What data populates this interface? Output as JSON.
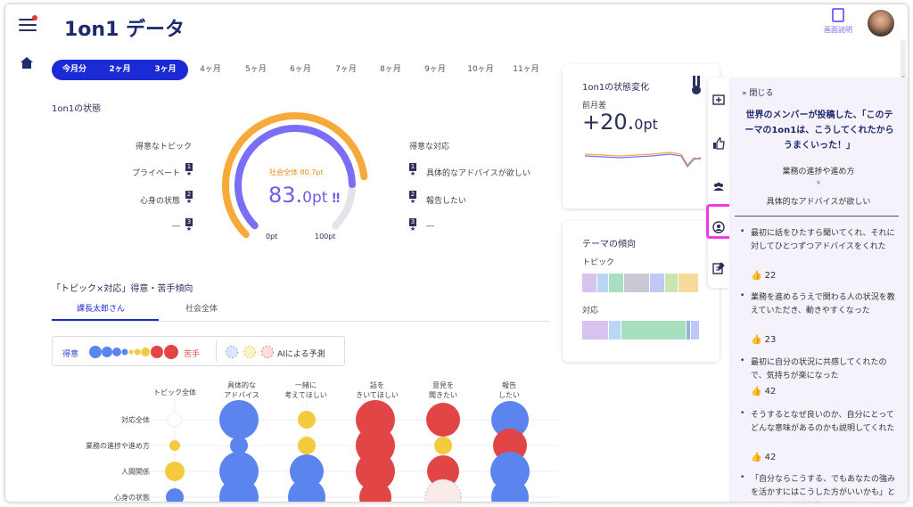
{
  "header": {
    "title": "1on1 データ",
    "help_label": "画面説明"
  },
  "period": {
    "active": [
      "今月分",
      "2ヶ月",
      "3ヶ月"
    ],
    "others": [
      "4ヶ月",
      "5ヶ月",
      "6ヶ月",
      "7ヶ月",
      "8ヶ月",
      "9ヶ月",
      "10ヶ月",
      "11ヶ月"
    ]
  },
  "status": {
    "title": "1on1の状態",
    "good_topics": {
      "label": "得意なトピック",
      "items": [
        {
          "rank": "1",
          "name": "プライベート"
        },
        {
          "rank": "2",
          "name": "心身の状態"
        },
        {
          "rank": "3",
          "name": "―"
        }
      ]
    },
    "good_responses": {
      "label": "得意な対応",
      "items": [
        {
          "rank": "1",
          "name": "具体的なアドバイスが欲しい"
        },
        {
          "rank": "2",
          "name": "報告したい"
        },
        {
          "rank": "3",
          "name": "―"
        }
      ]
    },
    "gauge": {
      "society_label": "社会全体 80.7pt",
      "value_int": "83.",
      "value_dec": "0pt",
      "min": "0pt",
      "max": "100pt",
      "value": 83.0,
      "society_value": 80.7
    }
  },
  "trend": {
    "title": "「トピック×対応」得意・苦手傾向",
    "tabs": [
      "課長太郎さん",
      "社会全体"
    ],
    "legend_good": "得意",
    "legend_bad": "苦手",
    "legend_ai": "AIによる予測",
    "columns": [
      "トピック全体",
      "具体的な\nアドバイス",
      "一緒に\n考えてほしい",
      "話を\nきいてほしい",
      "意見を\n聞きたい",
      "報告\nしたい"
    ],
    "rows": [
      "対応全体",
      "業務の進捗や進め方",
      "人間関係",
      "心身の状態"
    ]
  },
  "change": {
    "title": "1on1の状態変化",
    "sub": "前月差",
    "value": "+20.",
    "unit": "0pt"
  },
  "theme": {
    "title": "テーマの傾向",
    "topic": "トピック",
    "response": "対応",
    "topic_colors": [
      "#d8c2f0",
      "#b9d6f5",
      "#a8e0bf",
      "#c9c9d4",
      "#c0c8f5",
      "#c9e6b2",
      "#f6dc9c"
    ],
    "response_colors": [
      "#d8c2f0",
      "#b9d6f5",
      "#a8e0bf",
      "#9ab1d8",
      "#c0c8f5"
    ]
  },
  "panel": {
    "close": "閉じる",
    "headline": "世界のメンバーが投稿した、「このテーマの1on1は、こうしてくれたからうまくいった！」",
    "topic": "業務の進捗や進め方",
    "x": "×",
    "response": "具体的なアドバイスが欲しい",
    "comments": [
      {
        "text": "最初に話をひたすら聞いてくれ、それに対してひとつずつアドバイスをくれた",
        "likes": "22"
      },
      {
        "text": "業務を進めるうえで関わる人の状況を教えていただき、動きやすくなった",
        "likes": "23"
      },
      {
        "text": "最初に自分の状況に共感してくれたので、気持ちが楽になった",
        "likes": "42"
      },
      {
        "text": "そうするとなぜ良いのか、自分にとってどんな意味があるのかも説明してくれた",
        "likes": "42"
      },
      {
        "text": "「自分ならこうする、でもあなたの強みを活かすにはこうした方がいいかも」とアドバイスをくれた",
        "likes": ""
      }
    ]
  }
}
